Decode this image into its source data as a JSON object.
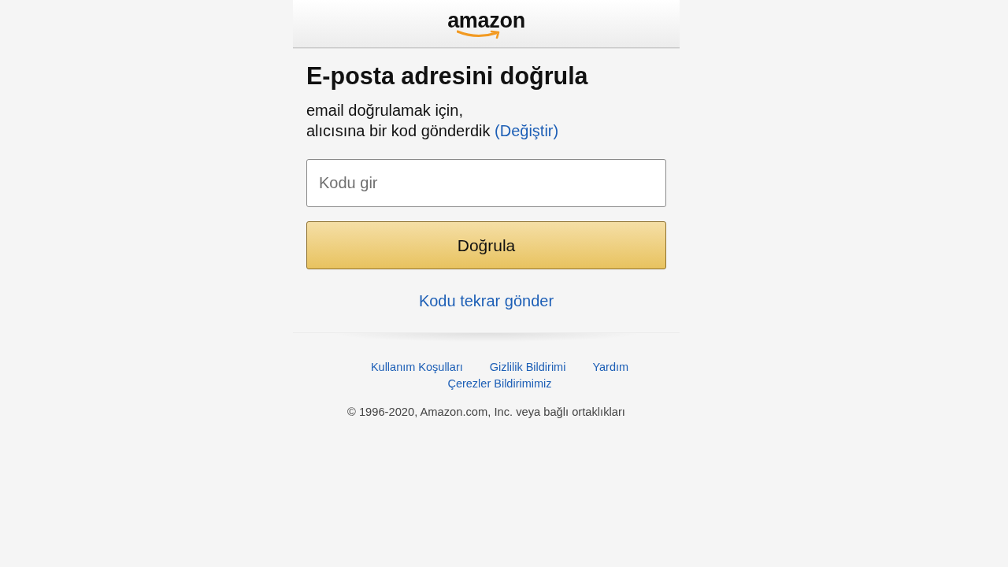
{
  "header": {
    "logo": "amazon"
  },
  "title": "E-posta adresini doğrula",
  "message": {
    "line_1": "email doğrulamak için,",
    "line_2": "alıcısına bir kod gönderdik",
    "change_link": "(Değiştir)"
  },
  "code_field": {
    "placeholder": "Kodu gir"
  },
  "verify_button": "Doğrula",
  "resend_link": "Kodu tekrar gönder",
  "footer": {
    "links": [
      "Kullanım Koşulları",
      "Gizlilik Bildirimi",
      "Yardım",
      "Çerezler Bildirimimiz"
    ],
    "copyright": "© 1996-2020, Amazon.com, Inc. veya bağlı ortaklıkları"
  }
}
